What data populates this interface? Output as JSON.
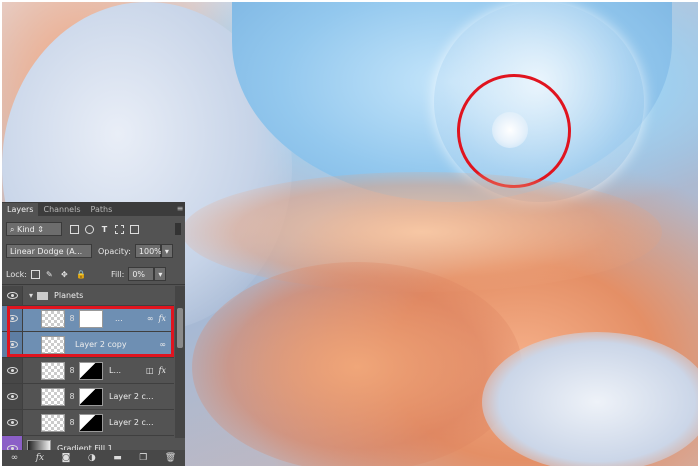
{
  "panel": {
    "tabs": [
      "Layers",
      "Channels",
      "Paths"
    ],
    "filter_kind": "Kind",
    "blend_mode": "Linear Dodge (A...",
    "opacity_label": "Opacity:",
    "opacity_value": "100%",
    "lock_label": "Lock:",
    "fill_label": "Fill:",
    "fill_value": "0%"
  },
  "layers": [
    {
      "name": "Planets",
      "type": "group"
    },
    {
      "name": "...",
      "type": "layer-mask",
      "selected": true
    },
    {
      "name": "Layer 2 copy",
      "type": "layer",
      "selected": true
    },
    {
      "name": "L...",
      "type": "layer-mask"
    },
    {
      "name": "Layer 2 c...",
      "type": "layer-mask"
    },
    {
      "name": "Layer 2 c...",
      "type": "layer-mask"
    },
    {
      "name": "Gradient Fill 1",
      "type": "gradient"
    }
  ],
  "icons": {
    "fx": "fx",
    "link": "∞"
  },
  "colors": {
    "highlight": "#e0141f",
    "selected_layer": "#6e8fb3",
    "panel_bg": "#535353"
  }
}
